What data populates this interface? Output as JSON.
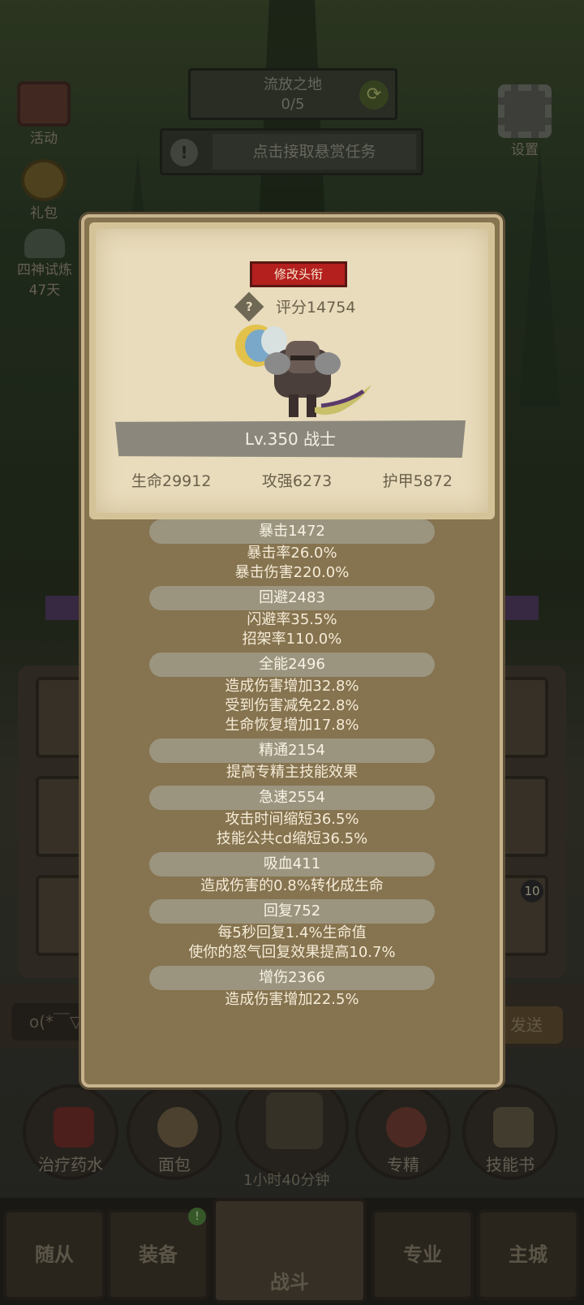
{
  "background": {
    "stage": {
      "name": "流放之地",
      "progress": "0/5"
    },
    "bounty_button": "点击接取悬赏任务",
    "side_left": [
      {
        "label": "活动"
      },
      {
        "label": "礼包"
      },
      {
        "label": "四神试炼",
        "sub": "47天"
      }
    ],
    "settings_label": "设置",
    "chat": {
      "input_value": "o(*￣▽",
      "send_label": "发送"
    },
    "quick_items": [
      "治疗药水",
      "面包",
      "专精",
      "技能书"
    ],
    "chest_timer": "1小时40分钟",
    "tabs": [
      "随从",
      "装备",
      "战斗",
      "专业",
      "主城"
    ],
    "tab_badge": "!",
    "slot_badge": "10"
  },
  "dialog": {
    "title_button": "修改头衔",
    "score": "评分14754",
    "level_class": "Lv.350 战士",
    "base_stats": {
      "hp": "生命29912",
      "attack": "攻强6273",
      "armor": "护甲5872"
    },
    "sections": [
      {
        "header": "暴击1472",
        "lines": [
          "暴击率26.0%",
          "暴击伤害220.0%"
        ]
      },
      {
        "header": "回避2483",
        "lines": [
          "闪避率35.5%",
          "招架率110.0%"
        ]
      },
      {
        "header": "全能2496",
        "lines": [
          "造成伤害增加32.8%",
          "受到伤害减免22.8%",
          "生命恢复增加17.8%"
        ]
      },
      {
        "header": "精通2154",
        "lines": [
          "提高专精主技能效果"
        ]
      },
      {
        "header": "急速2554",
        "lines": [
          "攻击时间缩短36.5%",
          "技能公共cd缩短36.5%"
        ]
      },
      {
        "header": "吸血411",
        "lines": [
          "造成伤害的0.8%转化成生命"
        ]
      },
      {
        "header": "回复752",
        "lines": [
          "每5秒回复1.4%生命值",
          "使你的怒气回复效果提高10.7%"
        ]
      },
      {
        "header": "增伤2366",
        "lines": [
          "造成伤害增加22.5%"
        ]
      }
    ]
  },
  "colors": {
    "title_button_bg": "#b4201e",
    "parchment": "#e8dcbc",
    "dialog_bg": "#86734f",
    "stat_pill": "#9b9580"
  }
}
